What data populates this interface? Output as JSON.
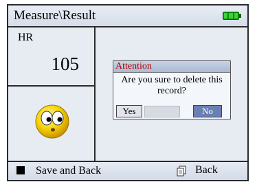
{
  "header": {
    "title": "Measure\\Result",
    "battery_icon": "battery-full-icon"
  },
  "result": {
    "hr_label": "HR",
    "hr_value": "105",
    "status_icon": "worried-face-icon"
  },
  "dialog": {
    "title": "Attention",
    "message": "Are you sure to delete this record?",
    "yes_label": "Yes",
    "no_label": "No",
    "selected": "No"
  },
  "footer": {
    "save_icon": "square-key-icon",
    "save_label": "Save and Back",
    "back_icon": "document-icon",
    "back_label": "Back"
  },
  "colors": {
    "dialog_title": "#b00000",
    "battery": "#0c8a0c",
    "selected_button": "#6a7fb4"
  }
}
